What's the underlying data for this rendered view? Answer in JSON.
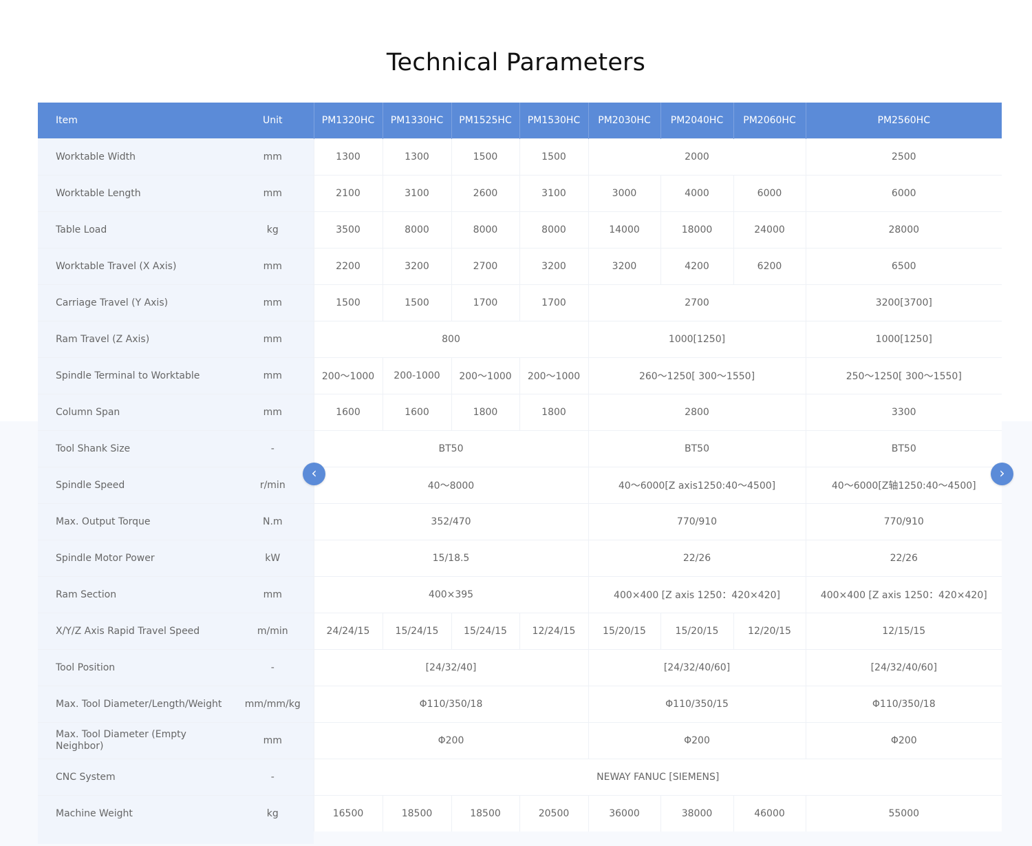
{
  "title": "Technical Parameters",
  "header": [
    "Item",
    "Unit",
    "PM1320HC",
    "PM1330HC",
    "PM1525HC",
    "PM1530HC",
    "PM2030HC",
    "PM2040HC",
    "PM2060HC",
    "PM2560HC"
  ],
  "rows": [
    {
      "item": "Worktable   Width",
      "unit": "mm",
      "cells": [
        {
          "v": "1300"
        },
        {
          "v": "1300"
        },
        {
          "v": "1500"
        },
        {
          "v": "1500"
        },
        {
          "v": "2000",
          "span": 3
        },
        {
          "v": "2500"
        }
      ]
    },
    {
      "item": "Worktable Length",
      "unit": "mm",
      "cells": [
        {
          "v": "2100"
        },
        {
          "v": "3100"
        },
        {
          "v": "2600"
        },
        {
          "v": "3100"
        },
        {
          "v": "3000"
        },
        {
          "v": "4000"
        },
        {
          "v": "6000"
        },
        {
          "v": "6000"
        }
      ]
    },
    {
      "item": "Table Load",
      "unit": "kg",
      "cells": [
        {
          "v": "3500"
        },
        {
          "v": "8000"
        },
        {
          "v": "8000"
        },
        {
          "v": "8000"
        },
        {
          "v": "14000"
        },
        {
          "v": "18000"
        },
        {
          "v": "24000"
        },
        {
          "v": "28000"
        }
      ]
    },
    {
      "item": "Worktable Travel (X Axis)",
      "unit": "mm",
      "cells": [
        {
          "v": "2200"
        },
        {
          "v": "3200"
        },
        {
          "v": "2700"
        },
        {
          "v": "3200"
        },
        {
          "v": "3200"
        },
        {
          "v": "4200"
        },
        {
          "v": "6200"
        },
        {
          "v": "6500"
        }
      ]
    },
    {
      "item": "Carriage Travel (Y Axis)",
      "unit": "mm",
      "cells": [
        {
          "v": "1500"
        },
        {
          "v": "1500"
        },
        {
          "v": "1700"
        },
        {
          "v": "1700"
        },
        {
          "v": "2700",
          "span": 3
        },
        {
          "v": "3200[3700]"
        }
      ]
    },
    {
      "item": "Ram Travel (Z Axis)",
      "unit": "mm",
      "cells": [
        {
          "v": "800",
          "span": 4
        },
        {
          "v": "1000[1250]",
          "span": 3
        },
        {
          "v": "1000[1250]"
        }
      ]
    },
    {
      "item": "Spindle Terminal to Worktable",
      "unit": "mm",
      "cells": [
        {
          "v": "200～1000"
        },
        {
          "v": "200-1000"
        },
        {
          "v": "200～1000"
        },
        {
          "v": "200～1000"
        },
        {
          "v": "260～1250[   300～1550]",
          "span": 3
        },
        {
          "v": "250～1250[ 300～1550]"
        }
      ]
    },
    {
      "item": "Column Span",
      "unit": "mm",
      "cells": [
        {
          "v": "1600"
        },
        {
          "v": "1600"
        },
        {
          "v": "1800"
        },
        {
          "v": "1800"
        },
        {
          "v": "2800",
          "span": 3
        },
        {
          "v": "3300"
        }
      ]
    },
    {
      "item": "Tool Shank Size",
      "unit": "-",
      "cells": [
        {
          "v": "BT50",
          "span": 4
        },
        {
          "v": "BT50",
          "span": 3
        },
        {
          "v": "BT50"
        }
      ]
    },
    {
      "item": "Spindle Speed",
      "unit": "r/min",
      "cells": [
        {
          "v": "40～8000",
          "span": 4
        },
        {
          "v": "40～6000[Z axis1250:40～4500]",
          "span": 3
        },
        {
          "v": "40～6000[Z轴1250:40～4500]"
        }
      ]
    },
    {
      "item": "Max. Output Torque",
      "unit": "N.m",
      "cells": [
        {
          "v": "352/470",
          "span": 4
        },
        {
          "v": "770/910",
          "span": 3
        },
        {
          "v": "770/910"
        }
      ]
    },
    {
      "item": "Spindle Motor Power",
      "unit": "kW",
      "cells": [
        {
          "v": "15/18.5",
          "span": 4
        },
        {
          "v": "22/26",
          "span": 3
        },
        {
          "v": "22/26"
        }
      ]
    },
    {
      "item": "Ram Section",
      "unit": "mm",
      "cells": [
        {
          "v": "400×395",
          "span": 4
        },
        {
          "v": "400×400 [Z axis    1250：420×420]",
          "span": 3
        },
        {
          "v": "400×400 [Z axis 1250：420×420]"
        }
      ]
    },
    {
      "item": "X/Y/Z Axis Rapid Travel    Speed",
      "unit": "m/min",
      "cells": [
        {
          "v": "24/24/15"
        },
        {
          "v": "15/24/15"
        },
        {
          "v": "15/24/15"
        },
        {
          "v": "12/24/15"
        },
        {
          "v": "15/20/15"
        },
        {
          "v": "15/20/15"
        },
        {
          "v": "12/20/15"
        },
        {
          "v": "12/15/15"
        }
      ]
    },
    {
      "item": "Tool Position",
      "unit": "-",
      "cells": [
        {
          "v": "[24/32/40]",
          "span": 4
        },
        {
          "v": "[24/32/40/60]",
          "span": 3
        },
        {
          "v": "[24/32/40/60]"
        }
      ]
    },
    {
      "item": "Max. Tool Diameter/Length/Weight",
      "unit": "mm/mm/kg",
      "cells": [
        {
          "v": "Φ110/350/18",
          "span": 4
        },
        {
          "v": "Φ110/350/15",
          "span": 3
        },
        {
          "v": "Φ110/350/18"
        }
      ]
    },
    {
      "item": "Max. Tool Diameter (Empty Neighbor)",
      "unit": "mm",
      "cells": [
        {
          "v": "Φ200",
          "span": 4
        },
        {
          "v": "Φ200",
          "span": 3
        },
        {
          "v": "Φ200"
        }
      ]
    },
    {
      "item": "CNC System",
      "unit": "-",
      "cells": [
        {
          "v": "NEWAY FANUC [SIEMENS]",
          "span": 8
        }
      ]
    },
    {
      "item": "Machine Weight",
      "unit": "kg",
      "cells": [
        {
          "v": "16500"
        },
        {
          "v": "18500"
        },
        {
          "v": "18500"
        },
        {
          "v": "20500"
        },
        {
          "v": "36000"
        },
        {
          "v": "38000"
        },
        {
          "v": "46000"
        },
        {
          "v": "55000"
        }
      ]
    }
  ],
  "nav": {
    "prev_icon": "chevron-left-icon",
    "next_icon": "chevron-right-icon",
    "prev_glyph": "‹",
    "next_glyph": "›"
  }
}
